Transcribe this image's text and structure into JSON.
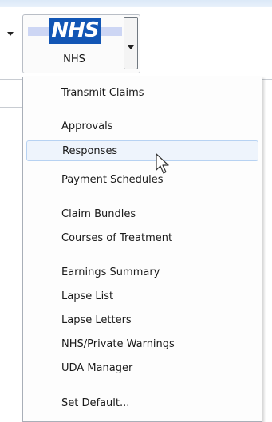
{
  "ribbon": {
    "nhs_button": {
      "logo_text": "NHS",
      "label": "NHS"
    }
  },
  "menu": {
    "items": [
      {
        "label": "Transmit Claims"
      },
      {
        "label": "Approvals"
      },
      {
        "label": "Responses",
        "hovered": true
      },
      {
        "label": "Payment Schedules"
      },
      {
        "label": "Claim Bundles"
      },
      {
        "label": "Courses of Treatment"
      },
      {
        "label": "Earnings Summary"
      },
      {
        "label": "Lapse List"
      },
      {
        "label": "Lapse Letters"
      },
      {
        "label": "NHS/Private Warnings"
      },
      {
        "label": "UDA Manager"
      },
      {
        "label": "Set Default..."
      }
    ]
  },
  "colors": {
    "nhs_blue": "#1256b5",
    "hover_fill": "#eef4fc",
    "hover_border": "#b7d2f2"
  }
}
